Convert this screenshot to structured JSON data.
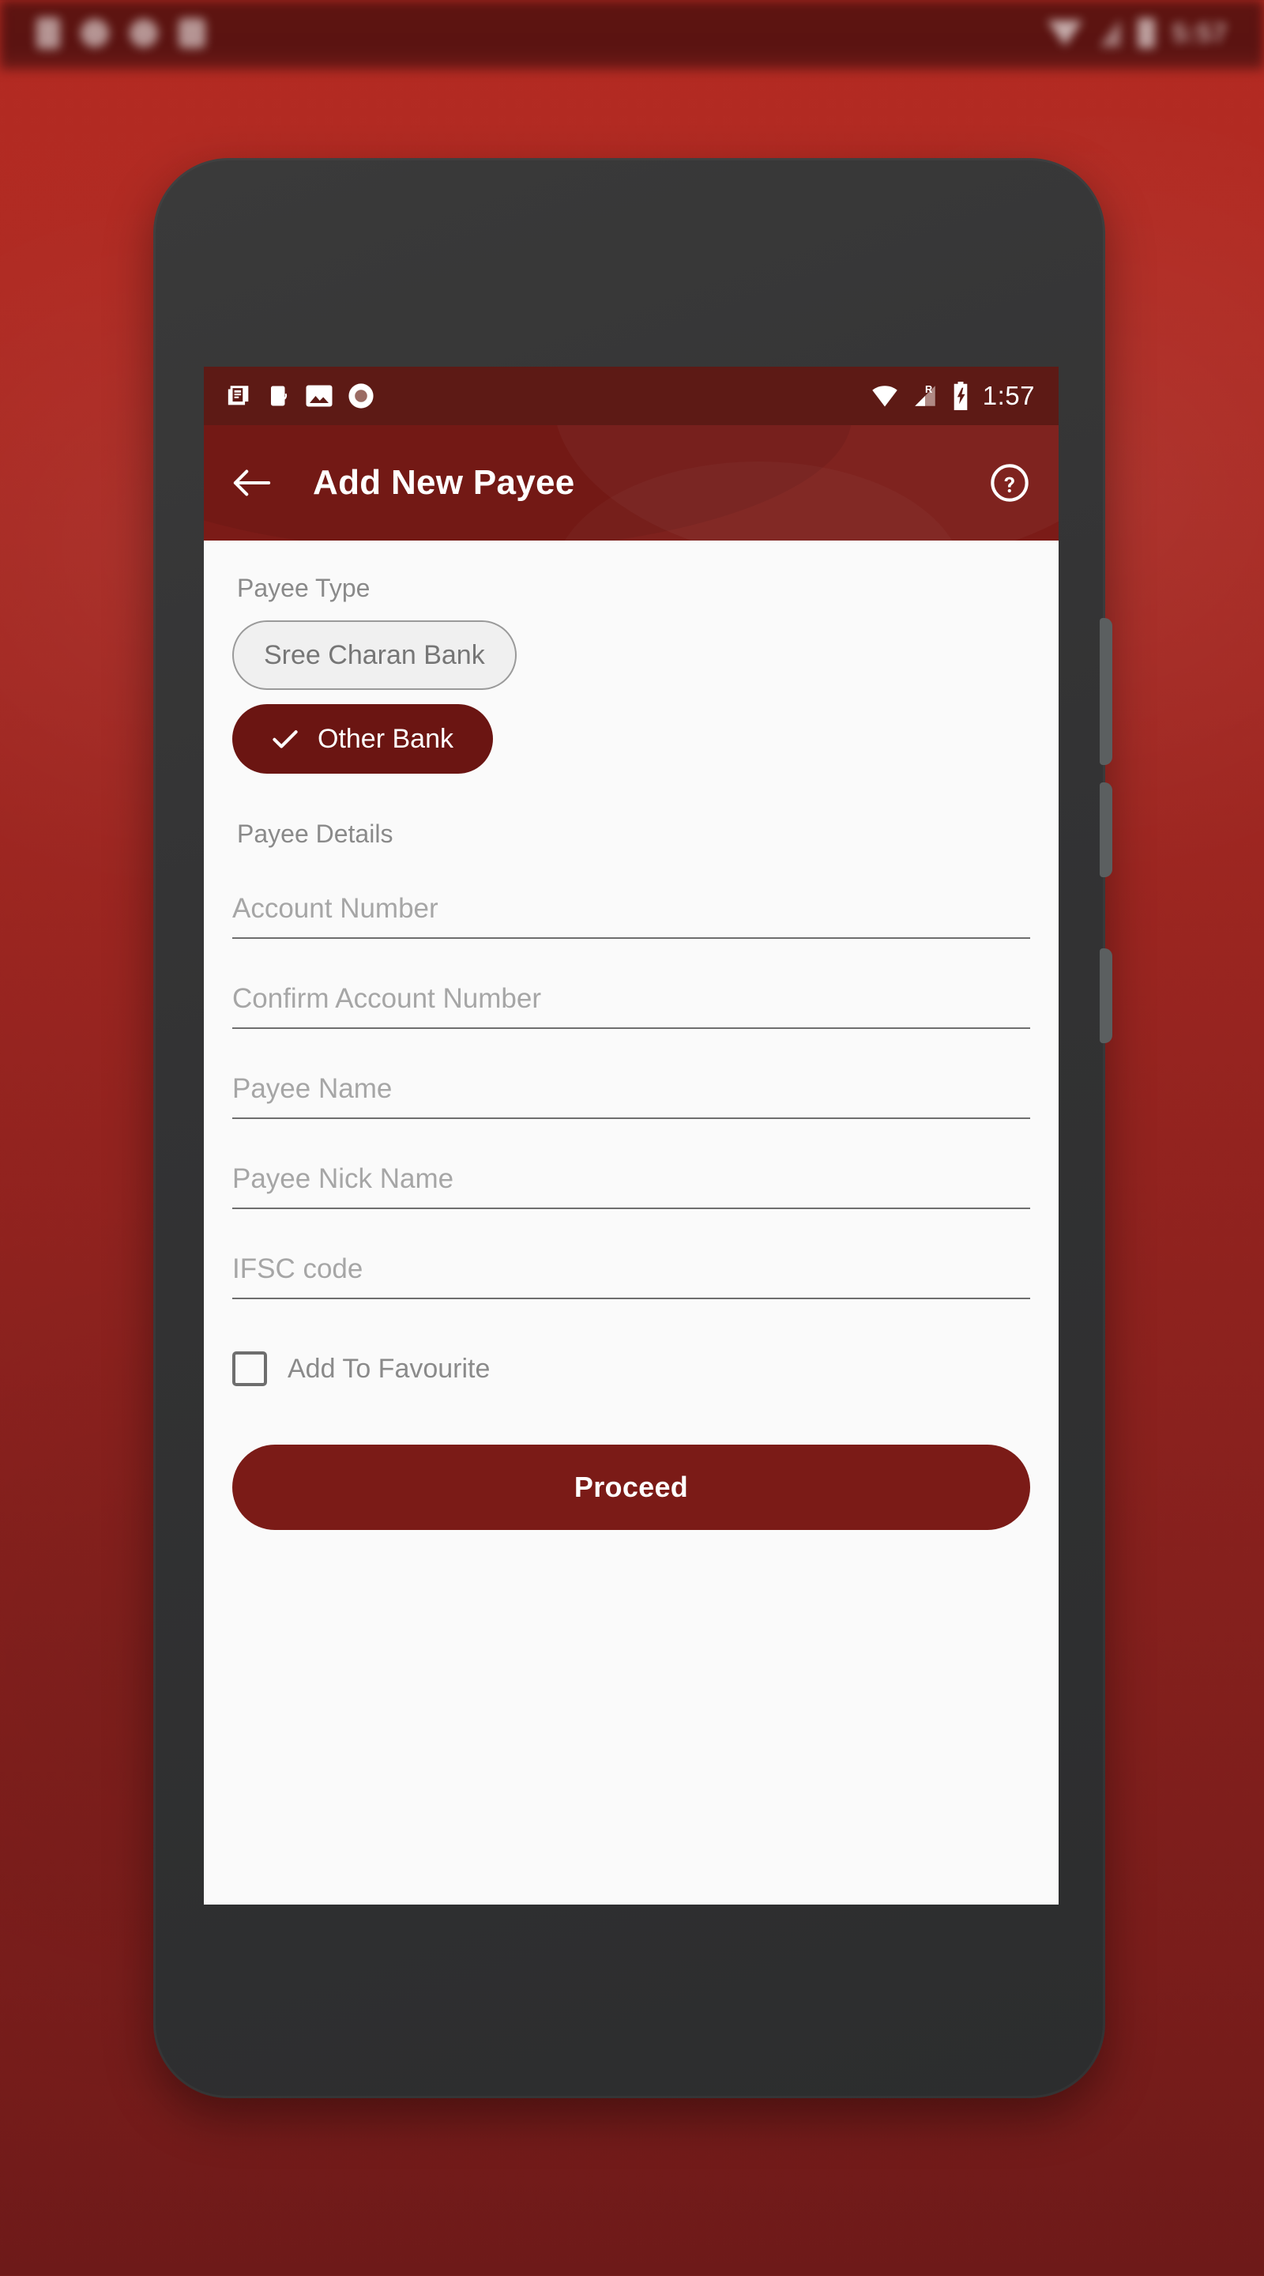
{
  "host_status_bar": {
    "icons": [
      "sim-icon",
      "record-icon",
      "record-icon",
      "app-icon"
    ],
    "right_icons": [
      "wifi-icon",
      "signal-icon",
      "battery-icon"
    ],
    "time": "5:57"
  },
  "phone": {
    "status_bar": {
      "left_icons": [
        "news-article-icon",
        "phone-sync-icon",
        "image-icon",
        "record-dot-icon"
      ],
      "right_icons": [
        "wifi-icon",
        "roaming-signal-icon",
        "battery-charging-icon"
      ],
      "roaming_label": "R",
      "time": "1:57"
    },
    "app_bar": {
      "back_label": "back-arrow",
      "title": "Add New Payee",
      "help_label": "help"
    },
    "content": {
      "payee_type_label": "Payee Type",
      "payee_type_options": [
        {
          "label": "Sree Charan Bank",
          "selected": false
        },
        {
          "label": "Other Bank",
          "selected": true
        }
      ],
      "payee_details_label": "Payee Details",
      "fields": [
        {
          "placeholder": "Account Number",
          "value": ""
        },
        {
          "placeholder": "Confirm Account Number",
          "value": ""
        },
        {
          "placeholder": "Payee Name",
          "value": ""
        },
        {
          "placeholder": "Payee Nick Name",
          "value": ""
        },
        {
          "placeholder": "IFSC code",
          "value": ""
        }
      ],
      "favourite": {
        "label": "Add To Favourite",
        "checked": false
      },
      "primary_action": "Proceed"
    }
  },
  "colors": {
    "brand_dark": "#7b1b17",
    "brand_darker": "#5d1a15",
    "chip_selected": "#6b1512",
    "screen_bg": "#fafafa",
    "device_body": "#333334",
    "wallpaper_top": "#b42a22",
    "wallpaper_bottom": "#6e1a19"
  }
}
